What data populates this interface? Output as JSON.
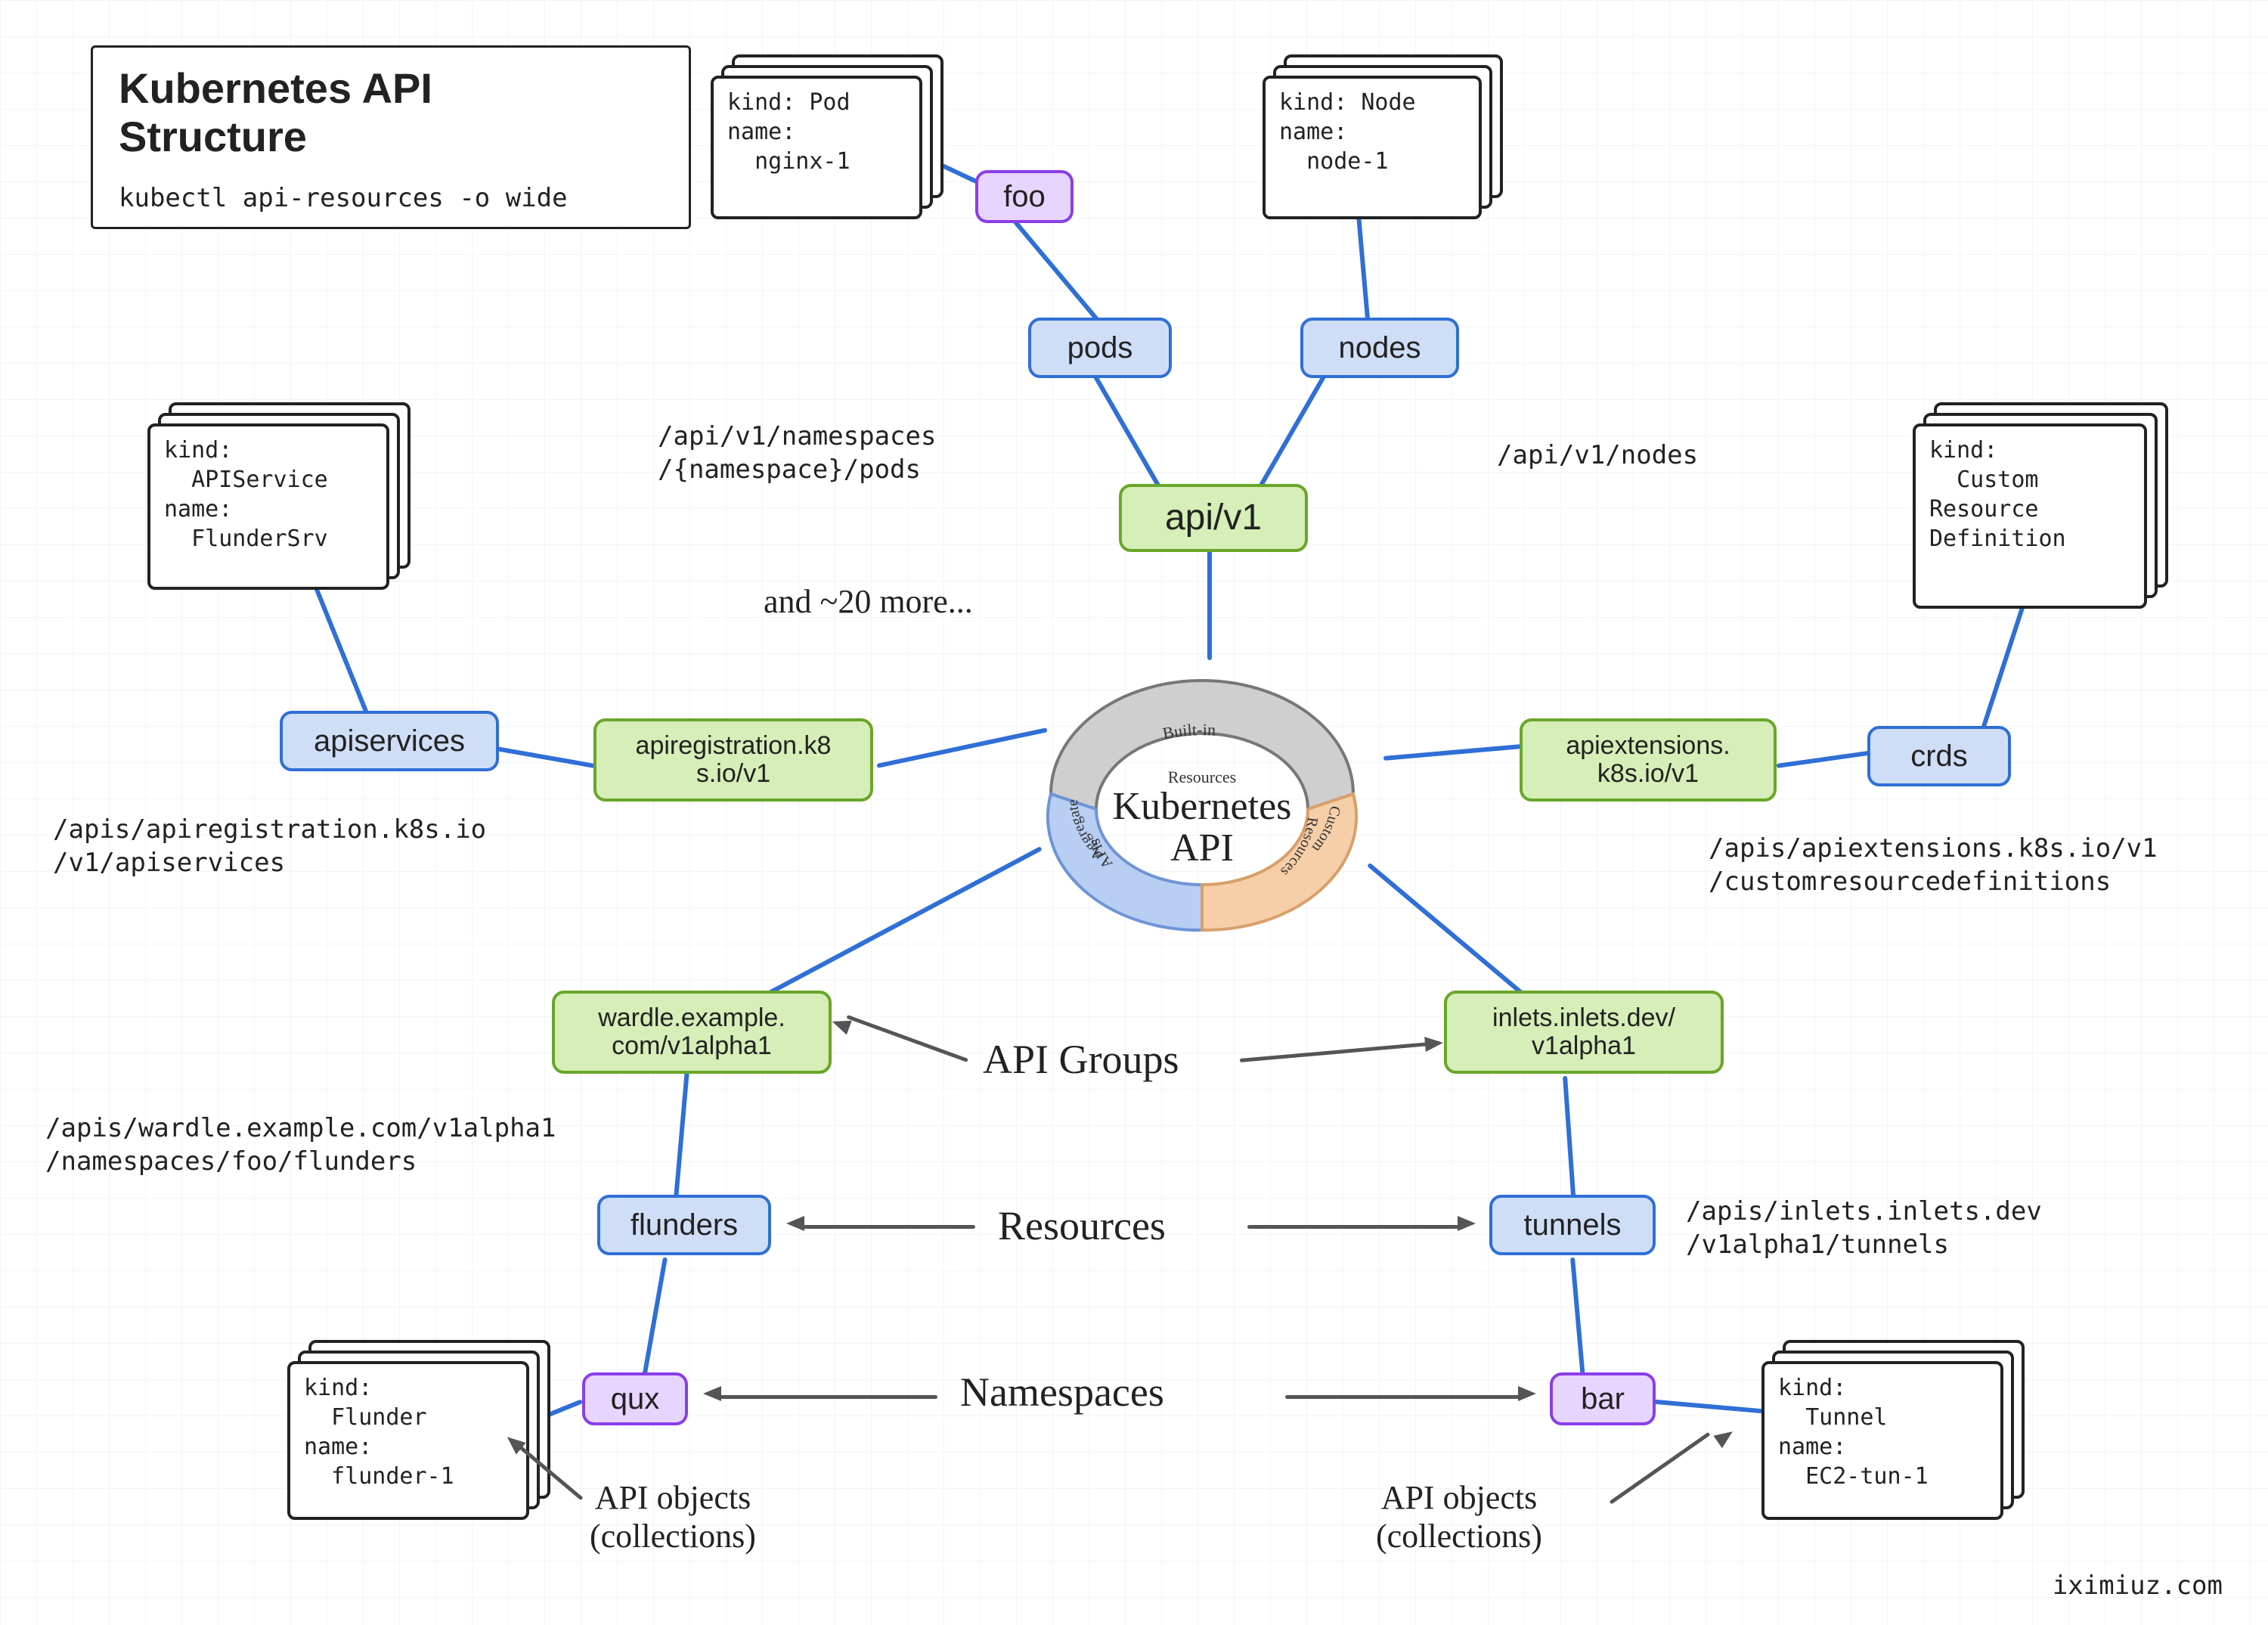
{
  "title": {
    "heading": "Kubernetes API\nStructure",
    "command": "kubectl api-resources -o wide"
  },
  "center": {
    "label": "Kubernetes\nAPI",
    "segments": {
      "builtin": "Built-in\nResources",
      "aggregated": "Aggregated\nAPIs",
      "custom": "Custom\nResources"
    }
  },
  "legend": {
    "api_groups": "API Groups",
    "resources": "Resources",
    "namespaces": "Namespaces",
    "api_objects_left": "API objects\n(collections)",
    "api_objects_right": "API objects\n(collections)"
  },
  "misc": {
    "and_more": "and ~20 more...",
    "credit": "iximiuz.com"
  },
  "groups": {
    "core": "api/v1",
    "apiregistration": "apiregistration.k8\ns.io/v1",
    "apiextensions": "apiextensions.\nk8s.io/v1",
    "wardle": "wardle.example.\ncom/v1alpha1",
    "inlets": "inlets.inlets.dev/\nv1alpha1"
  },
  "resources": {
    "pods": "pods",
    "nodes": "nodes",
    "apiservices": "apiservices",
    "crds": "crds",
    "flunders": "flunders",
    "tunnels": "tunnels"
  },
  "namespaces": {
    "foo": "foo",
    "qux": "qux",
    "bar": "bar"
  },
  "paths": {
    "pods": "/api/v1/namespaces\n/{namespace}/pods",
    "nodes": "/api/v1/nodes",
    "apiservices": "/apis/apiregistration.k8s.io\n/v1/apiservices",
    "crds": "/apis/apiextensions.k8s.io/v1\n/customresourcedefinitions",
    "flunders": "/apis/wardle.example.com/v1alpha1\n/namespaces/foo/flunders",
    "tunnels": "/apis/inlets.inlets.dev\n/v1alpha1/tunnels"
  },
  "objects": {
    "pod": {
      "kind": "Pod",
      "name": "nginx-1"
    },
    "node": {
      "kind": "Node",
      "name": "node-1"
    },
    "apiservice": {
      "kind": "APIService",
      "name": "FlunderSrv"
    },
    "crd": {
      "kind_lines": "Custom\nResource\nDefinition"
    },
    "flunder": {
      "kind": "Flunder",
      "name": "flunder-1"
    },
    "tunnel": {
      "kind": "Tunnel",
      "name": "EC2-tun-1"
    }
  }
}
